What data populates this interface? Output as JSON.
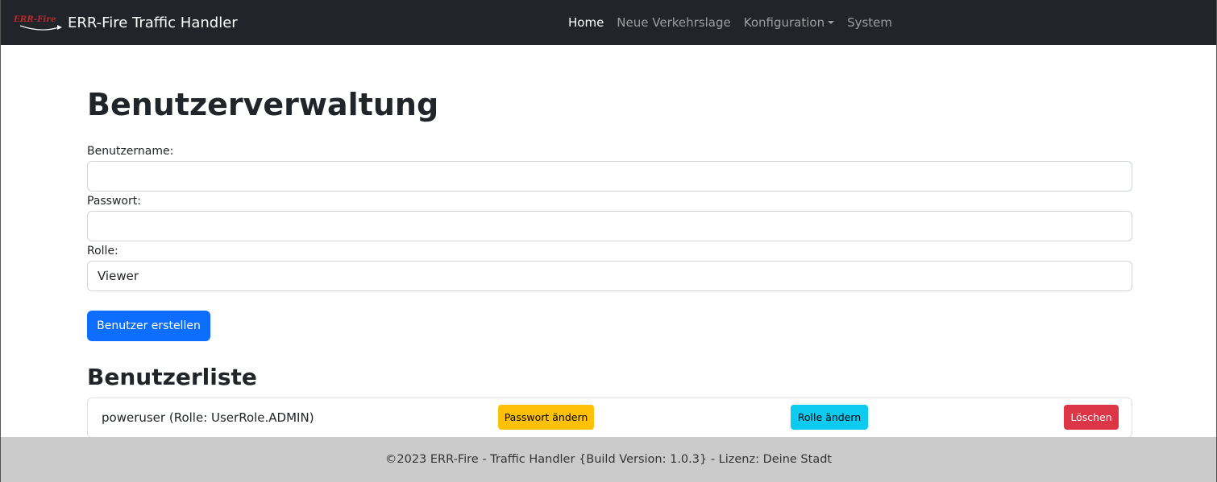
{
  "navbar": {
    "logo_text": "ERR-Fire",
    "title": "ERR-Fire Traffic Handler",
    "links": [
      {
        "label": "Home",
        "active": true
      },
      {
        "label": "Neue Verkehrslage",
        "active": false
      },
      {
        "label": "Konfiguration",
        "active": false,
        "dropdown": true
      },
      {
        "label": "System",
        "active": false
      }
    ]
  },
  "page": {
    "title": "Benutzerverwaltung",
    "form": {
      "username_label": "Benutzername:",
      "username_value": "",
      "password_label": "Passwort:",
      "password_value": "",
      "role_label": "Rolle:",
      "role_value": "Viewer",
      "submit_label": "Benutzer erstellen"
    },
    "list_title": "Benutzerliste",
    "users": [
      {
        "entry": "poweruser (Rolle: UserRole.ADMIN)",
        "change_password_label": "Passwort ändern",
        "change_role_label": "Rolle ändern",
        "delete_label": "Löschen"
      }
    ]
  },
  "footer": {
    "text": "©2023 ERR-Fire - Traffic Handler {Build Version: 1.0.3} - Lizenz: Deine Stadt"
  },
  "colors": {
    "navbar_bg": "#212529",
    "primary": "#0d6efd",
    "warning": "#ffc107",
    "info": "#0dcaf0",
    "danger": "#dc3545",
    "footer_bg": "#cbcbcb",
    "logo_red": "#c0262b"
  }
}
